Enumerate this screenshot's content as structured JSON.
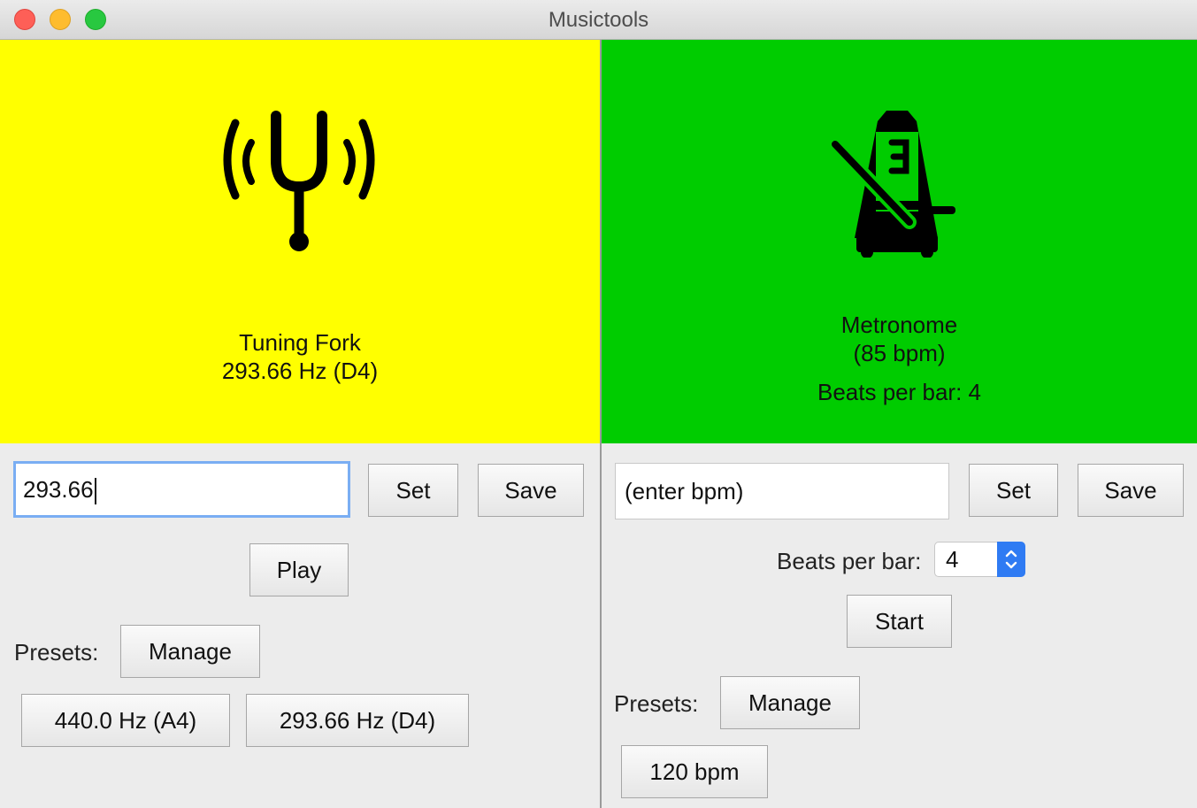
{
  "window": {
    "title": "Musictools"
  },
  "tuning_fork": {
    "icon": "tuning-fork-icon",
    "name": "Tuning Fork",
    "frequency_text": "293.66 Hz (D4)",
    "banner_color": "#ffff00",
    "input_value": "293.66",
    "set_label": "Set",
    "save_label": "Save",
    "play_label": "Play",
    "presets_label": "Presets:",
    "manage_label": "Manage",
    "presets": [
      {
        "label": "440.0 Hz (A4)"
      },
      {
        "label": "293.66 Hz (D4)"
      }
    ]
  },
  "metronome": {
    "icon": "metronome-off-icon",
    "name": "Metronome",
    "bpm_text": "(85 bpm)",
    "beats_text": "Beats per bar: 4",
    "banner_color": "#00cc00",
    "input_placeholder": "(enter bpm)",
    "set_label": "Set",
    "save_label": "Save",
    "beats_label": "Beats per bar:",
    "beats_value": "4",
    "start_label": "Start",
    "presets_label": "Presets:",
    "manage_label": "Manage",
    "presets": [
      {
        "label": "120 bpm"
      }
    ]
  }
}
